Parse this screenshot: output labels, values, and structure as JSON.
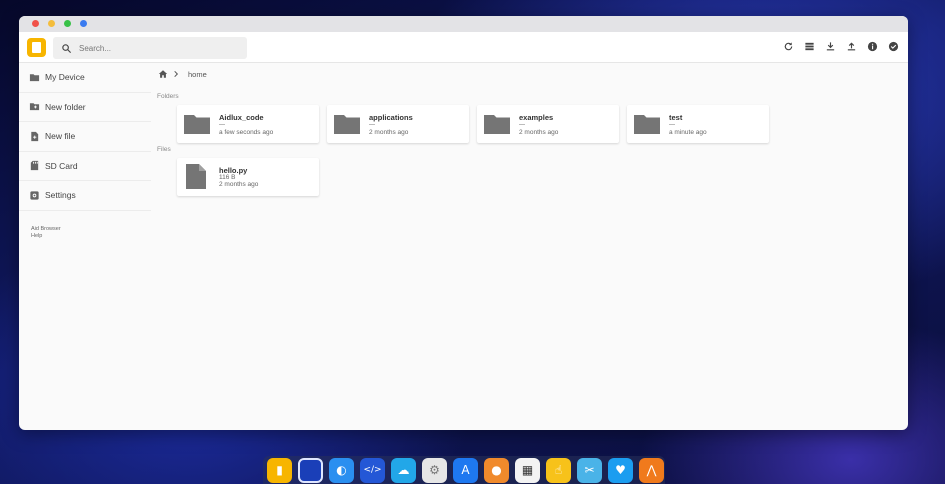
{
  "search": {
    "placeholder": "Search..."
  },
  "sidebar": {
    "items": [
      {
        "label": "My Device",
        "icon": "folder-icon"
      },
      {
        "label": "New folder",
        "icon": "new-folder-icon"
      },
      {
        "label": "New file",
        "icon": "new-file-icon"
      },
      {
        "label": "SD Card",
        "icon": "sd-card-icon"
      },
      {
        "label": "Settings",
        "icon": "settings-icon"
      }
    ],
    "footer": [
      "Aid Browser",
      "Help"
    ]
  },
  "breadcrumb": {
    "current": "home"
  },
  "sections": {
    "folders": "Folders",
    "files": "Files"
  },
  "folders": [
    {
      "name": "Aidlux_code",
      "sub": "—",
      "modified": "a few seconds ago"
    },
    {
      "name": "applications",
      "sub": "—",
      "modified": "2 months ago"
    },
    {
      "name": "examples",
      "sub": "—",
      "modified": "2 months ago"
    },
    {
      "name": "test",
      "sub": "—",
      "modified": "a minute ago"
    }
  ],
  "files": [
    {
      "name": "hello.py",
      "size": "116 B",
      "modified": "2 months ago"
    }
  ],
  "toolbar_icons": [
    "refresh-icon",
    "view-list-icon",
    "download-icon",
    "upload-icon",
    "info-icon",
    "select-icon"
  ],
  "dock_icons": [
    "files-icon",
    "terminal-icon",
    "browser-icon",
    "code-icon",
    "cloud-icon",
    "settings-icon",
    "app-store-icon",
    "bulb-icon",
    "calculator-icon",
    "touch-icon",
    "tools-icon",
    "butterfly-icon",
    "share-icon"
  ],
  "colors": {
    "accent": "#f7b500",
    "annotation": "#cc2222",
    "folder": "#757575"
  }
}
